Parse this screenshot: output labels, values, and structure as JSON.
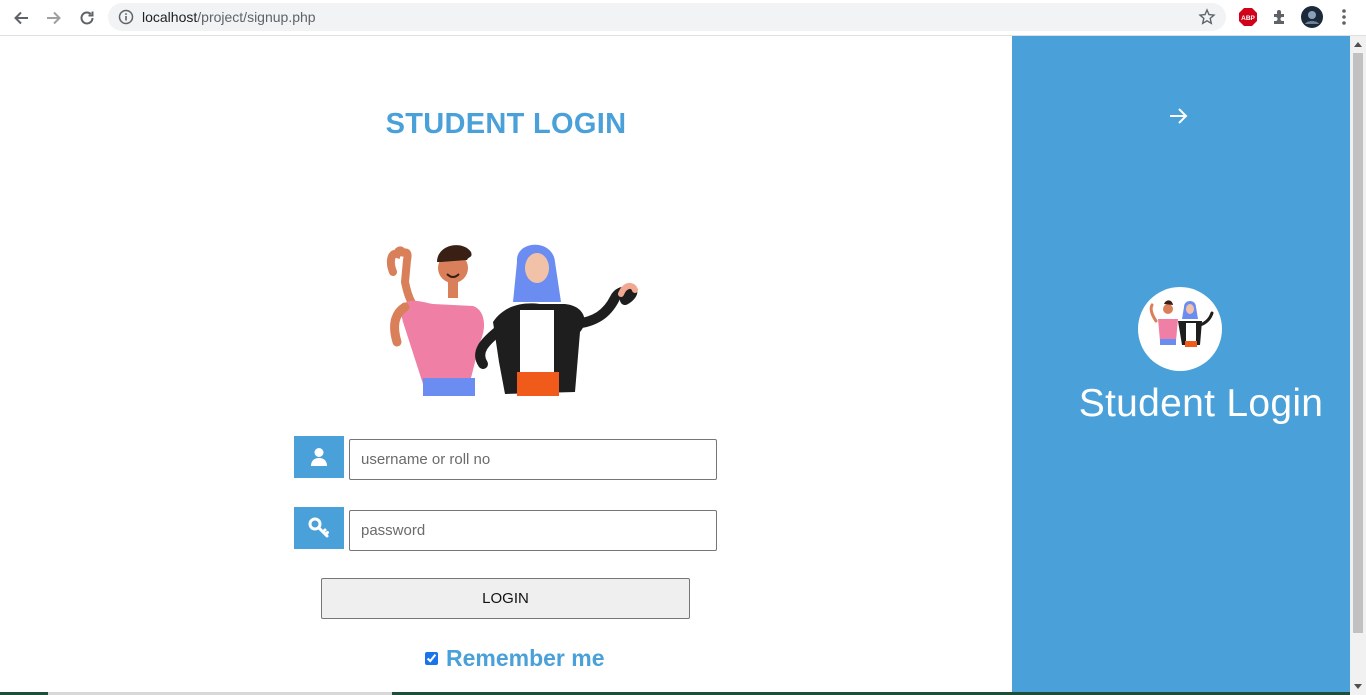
{
  "browser": {
    "url_host": "localhost",
    "url_path": "/project/signup.php",
    "extensions": [
      "abp-icon",
      "puzzle-icon",
      "profile-avatar"
    ],
    "abp_label": "ABP"
  },
  "page": {
    "title": "STUDENT LOGIN",
    "username_placeholder": "username or roll no",
    "password_placeholder": "password",
    "login_label": "LOGIN",
    "remember_label": "Remember me",
    "remember_checked": true
  },
  "side_panel": {
    "title": "Student Login"
  },
  "colors": {
    "accent": "#4aa0d8",
    "panel_text": "#ffffff"
  }
}
